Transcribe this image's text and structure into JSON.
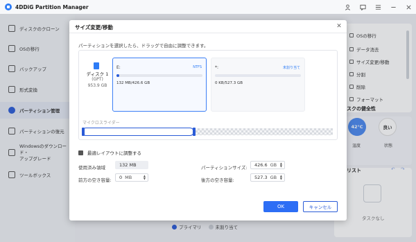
{
  "app": {
    "title": "4DDiG Partition Manager"
  },
  "window_controls": [
    "user-icon",
    "feedback-icon",
    "menu-icon",
    "minimize-icon",
    "close-icon"
  ],
  "sidebar": {
    "items": [
      {
        "label": "ディスクのクローン",
        "icon": "clone-icon"
      },
      {
        "label": "OSの移行",
        "icon": "os-icon"
      },
      {
        "label": "バックアップ",
        "icon": "backup-icon"
      },
      {
        "label": "形式変換",
        "icon": "convert-icon"
      },
      {
        "label": "パーティション管理",
        "icon": "partition-icon",
        "active": true
      },
      {
        "label": "パーティションの復元",
        "icon": "restore-icon"
      },
      {
        "label_line1": "Windowsのダウンロード・",
        "label_line2": "アップグレード",
        "icon": "windows-icon"
      },
      {
        "label": "ツールボックス",
        "icon": "toolbox-icon"
      }
    ]
  },
  "right_panel": {
    "actions": [
      "OSの移行",
      "データ消去",
      "サイズ変更/移動",
      "分割",
      "削除",
      "フォーマット"
    ],
    "health_title": "スクの健全性",
    "health": {
      "temp_value": "42°C",
      "temp_label": "温度",
      "status_value": "良い",
      "status_label": "状態"
    },
    "task_title": "スクリスト",
    "task_empty": "タスクなし"
  },
  "main": {
    "legend": [
      {
        "label": "プライマリ",
        "color": "#2a5bd7"
      },
      {
        "label": "未割り当て",
        "color": "#c8ccd4"
      }
    ]
  },
  "dialog": {
    "title": "サイズ変更/移動",
    "hint": "パーティションを選択したら、ドラッグで自由に調整できます。",
    "disk": {
      "name": "ディスク 1",
      "type": "(GPT)",
      "size": "953.9 GB"
    },
    "partitions": [
      {
        "name": "E:",
        "fs": "NTFS",
        "used": "132 MB/426.6 GB",
        "fill": 0.01
      },
      {
        "name": "*:",
        "fs": "未割り当て",
        "used": "0 KB/527.3 GB",
        "fill": 0
      }
    ],
    "slider_label": "マイクロスライダー",
    "checkbox_label": "最適レイアウトに調整する",
    "fields": {
      "used_label": "使用済み領域",
      "used_value": "132 MB",
      "before_label": "前方の空き容量:",
      "before_value": "0",
      "before_unit": "MB",
      "size_label": "パーティションサイズ:",
      "size_value": "426.6",
      "size_unit": "GB",
      "after_label": "後方の空き容量:",
      "after_value": "527.3",
      "after_unit": "GB"
    },
    "ok_label": "OK",
    "cancel_label": "キャンセル"
  },
  "colors": {
    "accent": "#2d6ef5",
    "selection": "#2a5bd7",
    "temp_circle": "#4a88f0",
    "status_circle": "#ffffff"
  }
}
